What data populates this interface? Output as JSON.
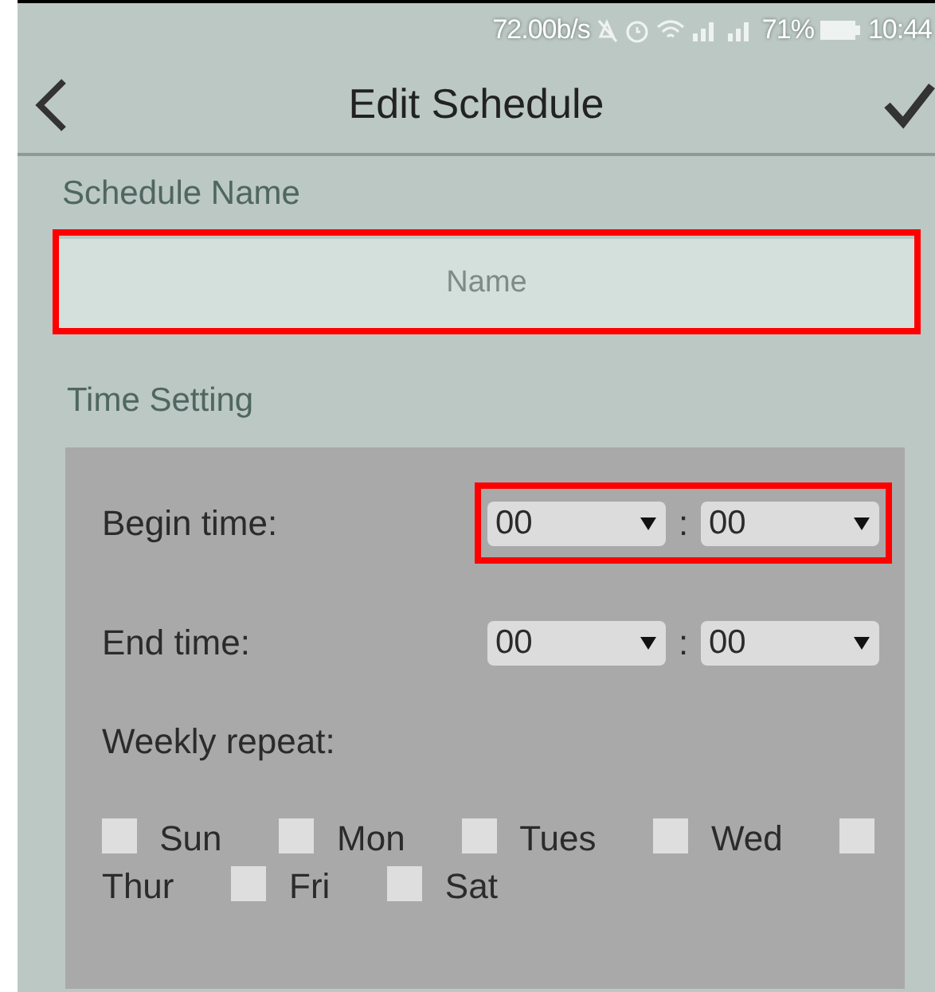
{
  "status_bar": {
    "speed": "72.00b/s",
    "battery": "71%",
    "time": "10:44"
  },
  "header": {
    "title": "Edit Schedule"
  },
  "schedule_name": {
    "label": "Schedule Name",
    "placeholder": "Name",
    "highlighted": true
  },
  "time_setting": {
    "label": "Time Setting",
    "rows": [
      {
        "label": "Begin time:",
        "hour": "00",
        "separator": ":",
        "minute": "00",
        "highlighted": true
      },
      {
        "label": "End time:",
        "hour": "00",
        "separator": ":",
        "minute": "00",
        "highlighted": false
      }
    ],
    "weekly_label": "Weekly repeat:",
    "days": [
      {
        "label": "Sun",
        "checked": false
      },
      {
        "label": "Mon",
        "checked": false
      },
      {
        "label": "Tues",
        "checked": false
      },
      {
        "label": "Wed",
        "checked": false
      },
      {
        "label": "Thur",
        "checked": false
      },
      {
        "label": "Fri",
        "checked": false
      },
      {
        "label": "Sat",
        "checked": false
      }
    ]
  }
}
